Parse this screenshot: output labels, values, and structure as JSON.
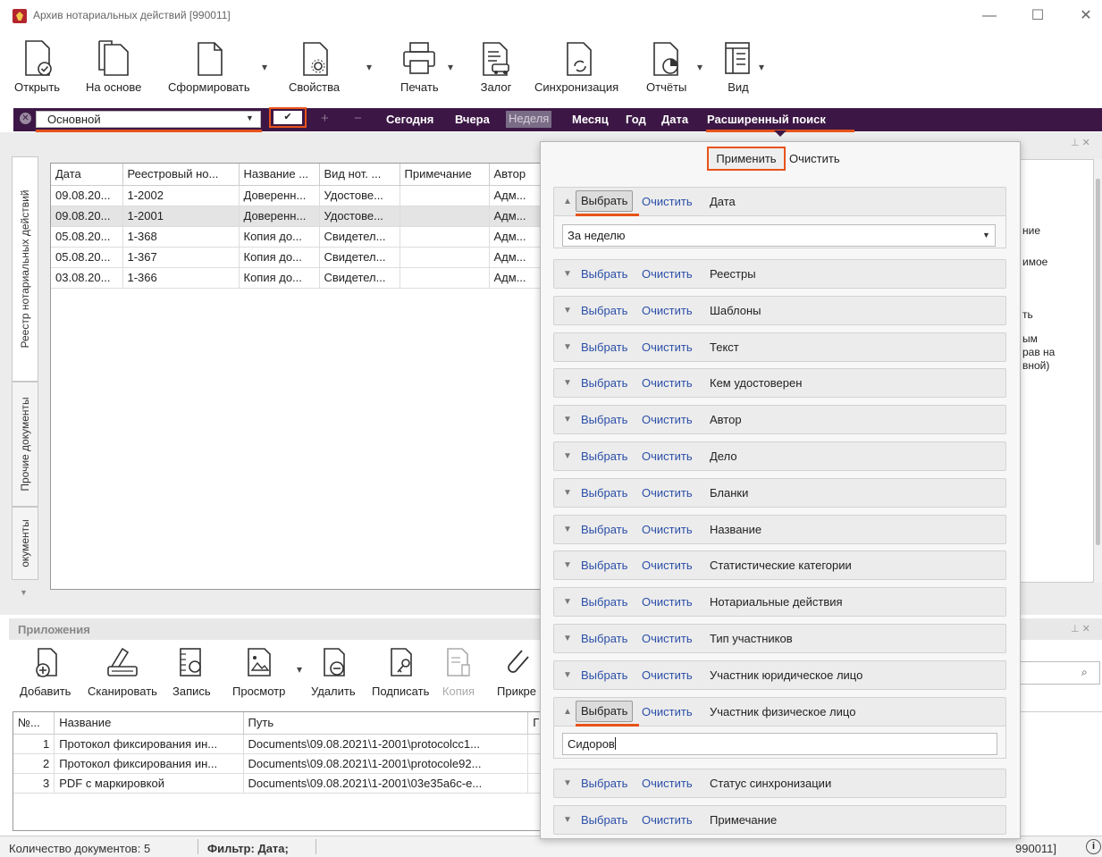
{
  "window": {
    "title": "Архив нотариальных действий [990011]",
    "controls": [
      "—",
      "☐",
      "✕"
    ]
  },
  "toolbar": {
    "open": "Открыть",
    "based_on": "На основе",
    "form": "Сформировать",
    "properties": "Свойства",
    "print": "Печать",
    "pledge": "Залог",
    "sync": "Синхронизация",
    "reports": "Отчёты",
    "view": "Вид"
  },
  "filterbar": {
    "preset": "Основной",
    "check": "✔",
    "plus": "+",
    "minus": "−",
    "today": "Сегодня",
    "yesterday": "Вчера",
    "week": "Неделя",
    "month": "Месяц",
    "year": "Год",
    "date": "Дата",
    "advanced": "Расширенный поиск"
  },
  "left_tabs": {
    "registry": "Реестр нотариальных действий",
    "other": "Прочие документы",
    "docs": "окументы"
  },
  "grid": {
    "columns": [
      "Дата",
      "Реестровый но...",
      "Название ...",
      "Вид нот. ...",
      "Примечание",
      "Автор"
    ],
    "rows": [
      [
        "09.08.20...",
        "1-2002",
        "Доверенн...",
        "Удостове...",
        "",
        "Адм..."
      ],
      [
        "09.08.20...",
        "1-2001",
        "Доверенн...",
        "Удостове...",
        "",
        "Адм..."
      ],
      [
        "05.08.20...",
        "1-368",
        "Копия до...",
        "Свидетел...",
        "",
        "Адм..."
      ],
      [
        "05.08.20...",
        "1-367",
        "Копия до...",
        "Свидетел...",
        "",
        "Адм..."
      ],
      [
        "03.08.20...",
        "1-366",
        "Копия до...",
        "Свидетел...",
        "",
        "Адм..."
      ]
    ]
  },
  "attachments": {
    "title": "Приложения",
    "buttons": {
      "add": "Добавить",
      "scan": "Сканировать",
      "record": "Запись",
      "preview": "Просмотр",
      "delete": "Удалить",
      "sign": "Подписать",
      "copy": "Копия",
      "attach": "Прикре"
    },
    "columns": [
      "№...",
      "Название",
      "Путь",
      "Г"
    ],
    "rows": [
      [
        "1",
        "Протокол фиксирования ин...",
        "Documents\\09.08.2021\\1-2001\\protocolcc1..."
      ],
      [
        "2",
        "Протокол фиксирования ин...",
        "Documents\\09.08.2021\\1-2001\\protocole92..."
      ],
      [
        "3",
        "PDF с маркировкой",
        "Documents\\09.08.2021\\1-2001\\03e35a6c-e..."
      ]
    ]
  },
  "statusbar": {
    "count": "Количество документов: 5",
    "filter": "Фильтр: Дата;",
    "right": "990011]",
    "info": "i"
  },
  "right_panel": {
    "lines": [
      "ние",
      "имое",
      "ть",
      "ым",
      "рав на",
      "вной)"
    ],
    "pin": "⊥ ✕"
  },
  "search_popup": {
    "apply": "Применить",
    "clear_all": "Очистить",
    "select": "Выбрать",
    "clear": "Очистить",
    "date_value": "За неделю",
    "person_value": "Сидоров",
    "sections": [
      {
        "name": "Дата",
        "open": true
      },
      {
        "name": "Реестры",
        "open": false
      },
      {
        "name": "Шаблоны",
        "open": false
      },
      {
        "name": "Текст",
        "open": false
      },
      {
        "name": "Кем удостоверен",
        "open": false
      },
      {
        "name": "Автор",
        "open": false
      },
      {
        "name": "Дело",
        "open": false
      },
      {
        "name": "Бланки",
        "open": false
      },
      {
        "name": "Название",
        "open": false
      },
      {
        "name": "Статистические категории",
        "open": false
      },
      {
        "name": "Нотариальные действия",
        "open": false
      },
      {
        "name": "Тип участников",
        "open": false
      },
      {
        "name": "Участник юридическое лицо",
        "open": false
      },
      {
        "name": "Участник физическое лицо",
        "open": true
      },
      {
        "name": "Статус синхронизации",
        "open": false
      },
      {
        "name": "Примечание",
        "open": false
      }
    ]
  },
  "colors": {
    "filterbar_bg": "#3c1745",
    "accent_highlight": "#e8531a",
    "link": "#2b4fa8"
  }
}
